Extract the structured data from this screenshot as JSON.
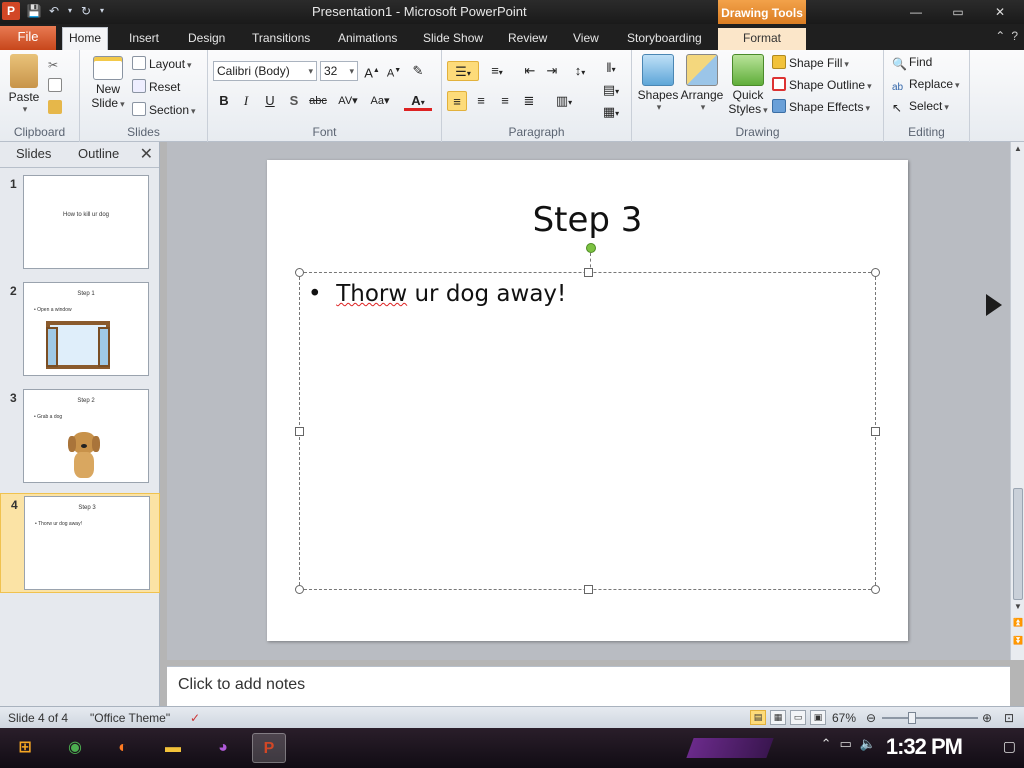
{
  "window": {
    "title": "Presentation1 - Microsoft PowerPoint",
    "app_icon_letter": "P",
    "contextual_tab_group": "Drawing Tools"
  },
  "tabs": [
    "File",
    "Home",
    "Insert",
    "Design",
    "Transitions",
    "Animations",
    "Slide Show",
    "Review",
    "View",
    "Storyboarding",
    "Format"
  ],
  "active_tab": "Home",
  "ribbon": {
    "clipboard": {
      "label": "Clipboard",
      "paste": "Paste"
    },
    "slides": {
      "label": "Slides",
      "new_slide_1": "New",
      "new_slide_2": "Slide",
      "layout": "Layout",
      "reset": "Reset",
      "section": "Section"
    },
    "font": {
      "label": "Font",
      "font_name": "Calibri (Body)",
      "font_size": "32"
    },
    "paragraph": {
      "label": "Paragraph"
    },
    "drawing": {
      "label": "Drawing",
      "shapes": "Shapes",
      "arrange": "Arrange",
      "quick_styles_1": "Quick",
      "quick_styles_2": "Styles",
      "shape_fill": "Shape Fill",
      "shape_outline": "Shape Outline",
      "shape_effects": "Shape Effects"
    },
    "editing": {
      "label": "Editing",
      "find": "Find",
      "replace": "Replace",
      "select": "Select"
    }
  },
  "panel": {
    "tab_slides": "Slides",
    "tab_outline": "Outline"
  },
  "slides": [
    {
      "num": "1",
      "title": "How to kill ur dog",
      "bullet": ""
    },
    {
      "num": "2",
      "title": "Step 1",
      "bullet": "Open a window"
    },
    {
      "num": "3",
      "title": "Step 2",
      "bullet": "Grab a dog"
    },
    {
      "num": "4",
      "title": "Step 3",
      "bullet": "Thorw ur dog away!"
    }
  ],
  "current_slide": {
    "title": "Step 3",
    "bullet_word_misspelled": "Thorw",
    "bullet_rest": " ur dog away!"
  },
  "notes_placeholder": "Click to add notes",
  "status": {
    "slide_indicator": "Slide 4 of 4",
    "theme": "\"Office Theme\"",
    "zoom": "67%"
  },
  "taskbar": {
    "clock": "1:32 PM"
  },
  "colors": {
    "file_tab": "#d24726",
    "drawing_tools": "#e88c2e",
    "selection_highlight": "#fddb7a",
    "rotation_handle": "#7cc242"
  }
}
